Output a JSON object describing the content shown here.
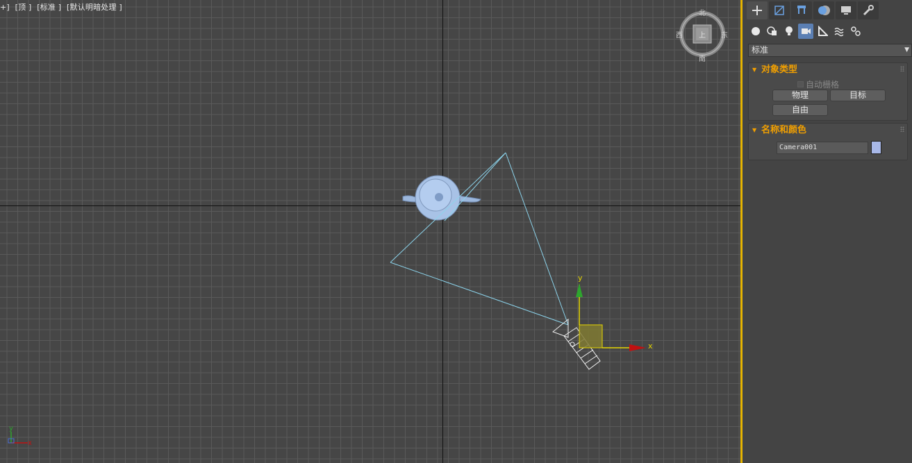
{
  "viewport": {
    "label_parts": [
      "+]",
      "[顶 ]",
      "[标准 ]",
      "[默认明暗处理 ]"
    ],
    "viewcube": {
      "north": "北",
      "south": "南",
      "east": "东",
      "west": "西",
      "face": "上"
    },
    "gizmo_x_label": "x",
    "gizmo_y_label": "y",
    "corner_axis_y": "y",
    "corner_axis_x": "x"
  },
  "command_panel": {
    "tabs": [
      "create-icon",
      "modify-icon",
      "hierarchy-icon",
      "motion-icon",
      "display-icon",
      "utilities-icon"
    ],
    "categories": [
      "geometry-icon",
      "shapes-icon",
      "lights-icon",
      "cameras-icon",
      "helpers-icon",
      "spacewarps-icon",
      "systems-icon"
    ],
    "active_category": "cameras-icon",
    "dropdown_value": "标准",
    "object_type": {
      "title": "对象类型",
      "autogrid_label": "自动栅格",
      "buttons": [
        "物理",
        "目标",
        "自由"
      ]
    },
    "name_color": {
      "title": "名称和颜色",
      "name_value": "Camera001",
      "color": "#a8b8e8"
    }
  },
  "colors": {
    "accent": "#f2a000",
    "active_border": "#e6b400",
    "category_active": "#5b7fb3"
  }
}
